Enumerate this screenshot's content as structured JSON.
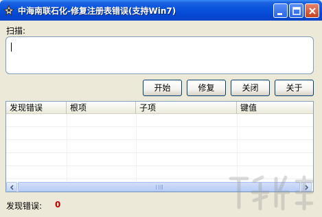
{
  "window": {
    "title": "中海南联石化-修复注册表错误(支持Win7)",
    "icons": {
      "app": "app-icon",
      "minimize": "minimize-icon",
      "maximize": "maximize-icon",
      "close": "close-icon"
    }
  },
  "scan": {
    "label": "扫描:",
    "value": ""
  },
  "buttons": {
    "start": "开始",
    "repair": "修复",
    "close": "关闭",
    "about": "关于"
  },
  "table": {
    "columns": [
      "发现错误",
      "根项",
      "子项",
      "键值"
    ],
    "rows": []
  },
  "status": {
    "label": "发现错误:",
    "count": "0"
  },
  "colors": {
    "titlebar": "#0a54de",
    "window_bg": "#ece9d8",
    "error_count": "#c00000"
  }
}
